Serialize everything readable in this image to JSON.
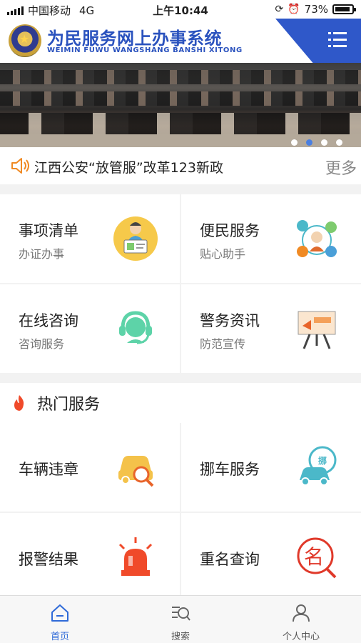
{
  "status_bar": {
    "carrier": "中国移动",
    "network": "4G",
    "time": "上午10:44",
    "battery": "73%"
  },
  "header": {
    "title": "为民服务网上办事系统",
    "subtitle": "WEIMIN FUWU WANGSHANG BANSHI XITONG",
    "menu_icon": "menu-list-icon"
  },
  "banner": {
    "slides": 4,
    "active_index": 1
  },
  "notice": {
    "text": "江西公安“放管服”改革123新政",
    "more_label": "更多"
  },
  "services": [
    {
      "title": "事项清单",
      "subtitle": "办证办事",
      "icon": "clerk-icon"
    },
    {
      "title": "便民服务",
      "subtitle": "贴心助手",
      "icon": "convenience-icon"
    },
    {
      "title": "在线咨询",
      "subtitle": "咨询服务",
      "icon": "headset-icon"
    },
    {
      "title": "警务资讯",
      "subtitle": "防范宣传",
      "icon": "billboard-icon"
    }
  ],
  "hot": {
    "title": "热门服务",
    "items": [
      {
        "title": "车辆违章",
        "icon": "car-search-icon"
      },
      {
        "title": "挪车服务",
        "icon": "move-car-icon"
      },
      {
        "title": "报警结果",
        "icon": "alarm-light-icon"
      },
      {
        "title": "重名查询",
        "icon": "name-search-icon"
      }
    ]
  },
  "tabbar": [
    {
      "label": "首页",
      "icon": "home-icon",
      "active": true
    },
    {
      "label": "搜索",
      "icon": "search-list-icon",
      "active": false
    },
    {
      "label": "个人中心",
      "icon": "user-icon",
      "active": false
    }
  ],
  "colors": {
    "brand_blue": "#2f58c9",
    "tab_active": "#2f6ad8",
    "notice_orange": "#f08a24"
  }
}
